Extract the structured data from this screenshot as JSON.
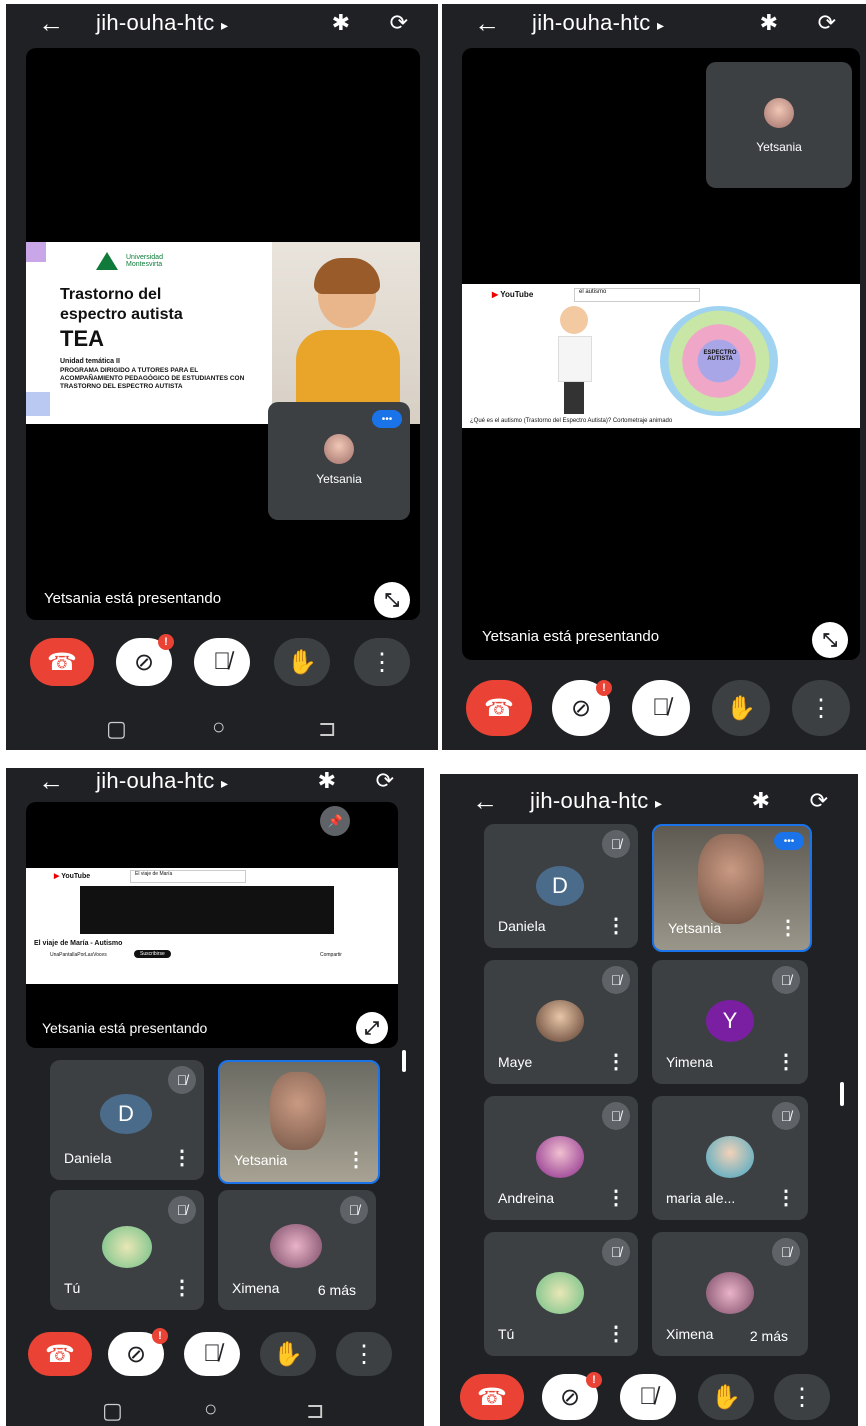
{
  "meeting_code": "jih-ouha-htc",
  "icons": {
    "back": "←",
    "caret": "▸",
    "bluetooth": "✱",
    "rotate": "⟳",
    "mic_off": "🎙̸",
    "cam_off": "⊘",
    "hand": "✋",
    "more": "⋮",
    "end_call": "☎",
    "collapse": "⤡",
    "expand": "⤢",
    "pin": "📌"
  },
  "presenting": "Yetsania está presentando",
  "slide": {
    "logo_text": "Universidad Montesvirta",
    "title_1": "Trastorno del",
    "title_2": "espectro autista",
    "title_3": "TEA",
    "unit": "Unidad temática II",
    "program": "PROGRAMA DIRIGIDO A TUTORES PARA EL ACOMPAÑAMIENTO PEDAGÓGICO DE ESTUDIANTES CON TRASTORNO DEL ESPECTRO AUTISTA"
  },
  "yt1": {
    "brand": "YouTube",
    "search": "el autismo",
    "caption": "¿Qué es el autismo (Trastorno del Espectro Autista)? Cortometraje animado",
    "center": "ESPECTRO AUTISTA"
  },
  "yt2": {
    "brand": "YouTube",
    "search": "El viaje de María",
    "title": "El viaje de María - Autismo",
    "channel": "UnaPantallaPorLasVoces",
    "subscribe": "Suscribirse",
    "share": "Compartir"
  },
  "participants": {
    "yetsania": "Yetsania",
    "daniela": "Daniela",
    "tu": "Tú",
    "ximena": "Ximena",
    "maye": "Maye",
    "yimena": "Yimena",
    "andreina": "Andreina",
    "maria": "maria ale...",
    "d_letter": "D",
    "y_letter": "Y"
  },
  "more3": "6 más",
  "more4": "2 más",
  "colors": {
    "bg": "#202124",
    "tile": "#3c4043",
    "end": "#ea4335",
    "active": "#1a73e8"
  }
}
